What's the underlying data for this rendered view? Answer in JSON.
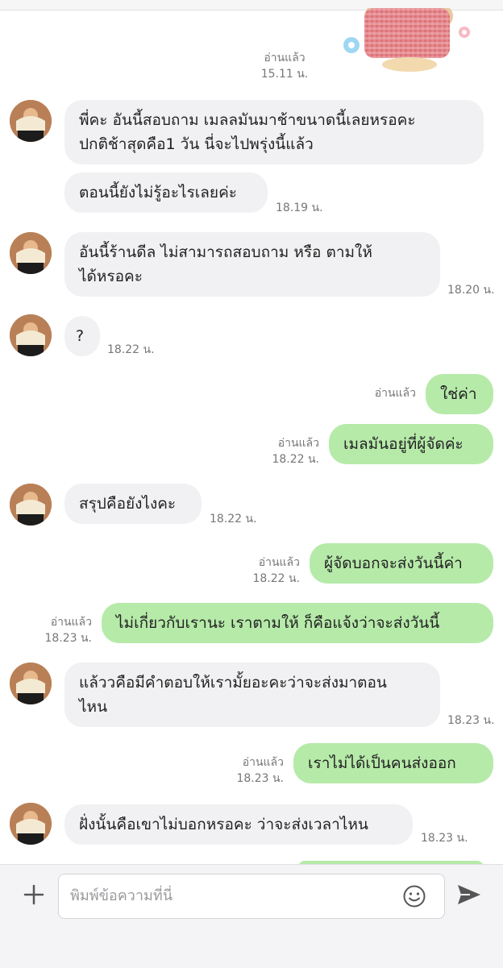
{
  "colors": {
    "incoming_bubble": "#f1f1f3",
    "outgoing_bubble": "#b6eaa9",
    "meta_text": "#777777"
  },
  "top_status": {
    "read": "อ่านแล้ว",
    "time": "15.11 น."
  },
  "messages": [
    {
      "dir": "in",
      "text_lines": [
        "พี่คะ อันนี้สอบถาม เมลลมันมาช้าขนาดนี้เลยหรอคะ",
        "ปกติช้าสุดคือ1 วัน นี่จะไปพรุ่งนี้แล้ว"
      ]
    },
    {
      "dir": "in",
      "text": "ตอนนี้ยังไม่รู้อะไรเลยค่ะ",
      "time": "18.19 น."
    },
    {
      "dir": "in",
      "text_lines": [
        "อันนี้ร้านดีล ไม่สามารถสอบถาม หรือ ตามให้",
        "ได้หรอคะ"
      ],
      "time": "18.20 น."
    },
    {
      "dir": "in",
      "text": "?",
      "time": "18.22 น."
    },
    {
      "dir": "out",
      "text": "ใช่ค่า",
      "read": "อ่านแล้ว"
    },
    {
      "dir": "out",
      "text": "เมลมันอยู่ที่ผู้จัดค่ะ",
      "read": "อ่านแล้ว",
      "time": "18.22 น."
    },
    {
      "dir": "in",
      "text": "สรุปคือยังไงคะ",
      "time": "18.22 น."
    },
    {
      "dir": "out",
      "text": "ผู้จัดบอกจะส่งวันนี้ค่า",
      "read": "อ่านแล้ว",
      "time": "18.22 น."
    },
    {
      "dir": "out",
      "text": "ไม่เกี่ยวกับเรานะ เราตามให้ ก็คือแจ้งว่าจะส่งวันนี้",
      "read": "อ่านแล้ว",
      "time": "18.23 น."
    },
    {
      "dir": "in",
      "text_lines": [
        "แล้ววคือมีคำตอบให้เรามั้ยอะคะว่าจะส่งมาตอน",
        "ไหน"
      ],
      "time": "18.23 น."
    },
    {
      "dir": "out",
      "text": "เราไม่ได้เป็นคนส่งออก",
      "read": "อ่านแล้ว",
      "time": "18.23 น."
    },
    {
      "dir": "in",
      "text": "ฝั่งนั้นคือเขาไม่บอกหรอคะ ว่าจะส่งเวลาไหน",
      "time": "18.23 น."
    }
  ],
  "composer": {
    "placeholder": "พิมพ์ข้อความที่นี่",
    "add_icon": "plus-icon",
    "emoji_icon": "smiley-icon",
    "send_icon": "send-arrow-icon"
  }
}
